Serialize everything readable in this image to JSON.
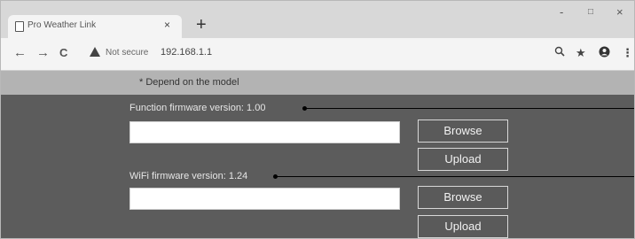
{
  "browser": {
    "tab_title": "Pro Weather Link",
    "tab_close": "×",
    "new_tab": "+",
    "window_controls": {
      "minimize": "-",
      "maximize": "□",
      "close": "×"
    },
    "nav": {
      "back": "←",
      "forward": "→",
      "reload": "C"
    },
    "security_label": "Not secure",
    "url": "192.168.1.1",
    "icons": {
      "zoom": "search-icon",
      "bookmark": "star-icon",
      "profile": "account-icon",
      "menu": "more-icon"
    }
  },
  "page": {
    "notice": "* Depend on the model",
    "function_section": {
      "label": "Function firmware version: 1.00",
      "file_value": "",
      "browse_label": "Browse",
      "upload_label": "Upload"
    },
    "wifi_section": {
      "label": "WiFi firmware version: 1.24",
      "file_value": "",
      "browse_label": "Browse",
      "upload_label": "Upload"
    }
  }
}
